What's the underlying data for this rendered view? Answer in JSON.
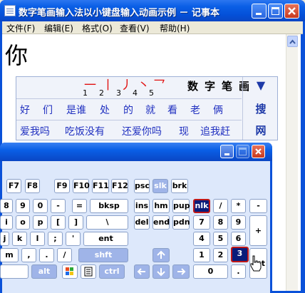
{
  "window": {
    "title": "数字笔画输入法以小键盘输入动画示例 － 记事本"
  },
  "menubar": [
    "文件(F)",
    "编辑(E)",
    "格式(O)",
    "查看(V)",
    "帮助(H)"
  ],
  "document": {
    "text": "你"
  },
  "ime": {
    "strokes": [
      "一",
      "丨",
      "丿",
      "丶",
      "乛"
    ],
    "stroke_indices": [
      "1",
      "2",
      "3",
      "4",
      "5"
    ],
    "mode_chars": [
      "数",
      "字",
      "笔",
      "画"
    ],
    "candidates_row1": [
      "好",
      "们",
      "是谁",
      "处",
      "的",
      "就",
      "看",
      "老",
      "俩"
    ],
    "candidates_row2": [
      "爱我吗",
      "吃饭没有",
      "还爱你吗",
      "现",
      "追我赶"
    ],
    "tools": {
      "arrow": "▼",
      "search": "搜",
      "web": "网"
    }
  },
  "keyboard": {
    "row_f": [
      "F7",
      "F8",
      "F9",
      "F10",
      "F11",
      "F12",
      "psc",
      "slk",
      "brk"
    ],
    "row_num": [
      "8",
      "9",
      "0",
      "-",
      "=",
      "bksp",
      "ins",
      "hm",
      "pup",
      "nlk",
      "/",
      "*",
      "-"
    ],
    "row_top": [
      "i",
      "o",
      "p",
      "[",
      "]",
      "\\",
      "del",
      "end",
      "pdn",
      "7",
      "8",
      "9"
    ],
    "row_home": [
      "j",
      "k",
      "l",
      ";",
      "'",
      "ent",
      "4",
      "5",
      "6",
      "+"
    ],
    "row_bottom": [
      "m",
      ",",
      ".",
      "/",
      "shft",
      "1",
      "2",
      "3"
    ],
    "row_space": [
      "alt",
      "ctrl",
      "0",
      "."
    ],
    "hidden_key": "nt"
  }
}
